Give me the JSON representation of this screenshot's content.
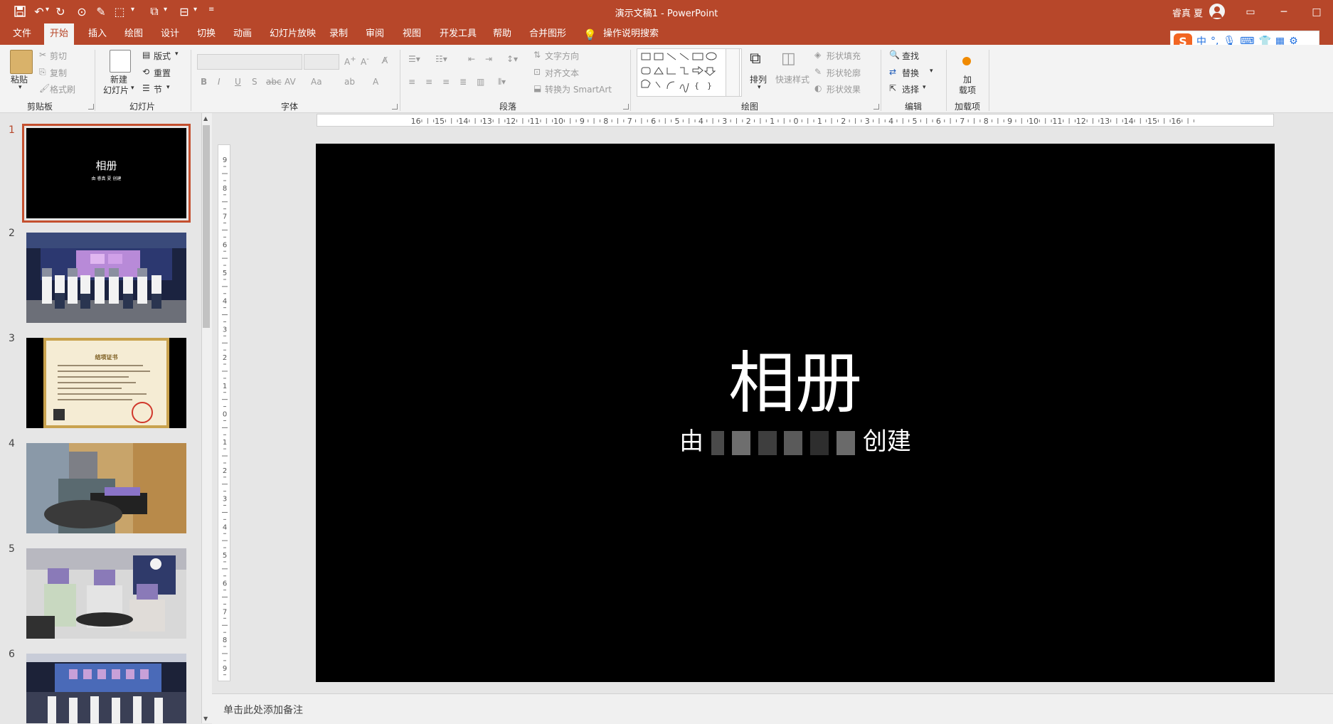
{
  "app": {
    "doc_title": "演示文稿1  -  PowerPoint",
    "user_name": "睿真 夏"
  },
  "tabs": [
    "文件",
    "开始",
    "插入",
    "绘图",
    "设计",
    "切换",
    "动画",
    "幻灯片放映",
    "录制",
    "审阅",
    "视图",
    "开发工具",
    "帮助",
    "合并图形"
  ],
  "tell_me": "操作说明搜索",
  "ribbon": {
    "clipboard": {
      "label": "剪贴板",
      "paste": "粘贴",
      "cut": "剪切",
      "copy": "复制",
      "format_painter": "格式刷"
    },
    "slides": {
      "label": "幻灯片",
      "new_slide_1": "新建",
      "new_slide_2": "幻灯片",
      "layout": "版式",
      "reset": "重置",
      "section": "节"
    },
    "font": {
      "label": "字体"
    },
    "paragraph": {
      "label": "段落",
      "text_direction": "文字方向",
      "align_text": "对齐文本",
      "convert_smartart": "转换为 SmartArt"
    },
    "drawing": {
      "label": "绘图",
      "arrange": "排列",
      "quick_styles": "快速样式",
      "shape_fill": "形状填充",
      "shape_outline": "形状轮廓",
      "shape_effects": "形状效果"
    },
    "editing": {
      "label": "编辑",
      "find": "查找",
      "replace": "替换",
      "select": "选择"
    },
    "addins": {
      "label": "加载项",
      "btn_1": "加",
      "btn_2": "载项"
    }
  },
  "ime": {
    "mode": "中"
  },
  "slides": [
    {
      "number": "1",
      "title": "相册",
      "subtitle": "由 睿真 夏 创建"
    },
    {
      "number": "2"
    },
    {
      "number": "3",
      "cert_title": "结项证书"
    },
    {
      "number": "4"
    },
    {
      "number": "5"
    },
    {
      "number": "6"
    }
  ],
  "main_slide": {
    "title": "相册",
    "subtitle_prefix": "由",
    "subtitle_suffix": "创建"
  },
  "notes_placeholder": "单击此处添加备注"
}
